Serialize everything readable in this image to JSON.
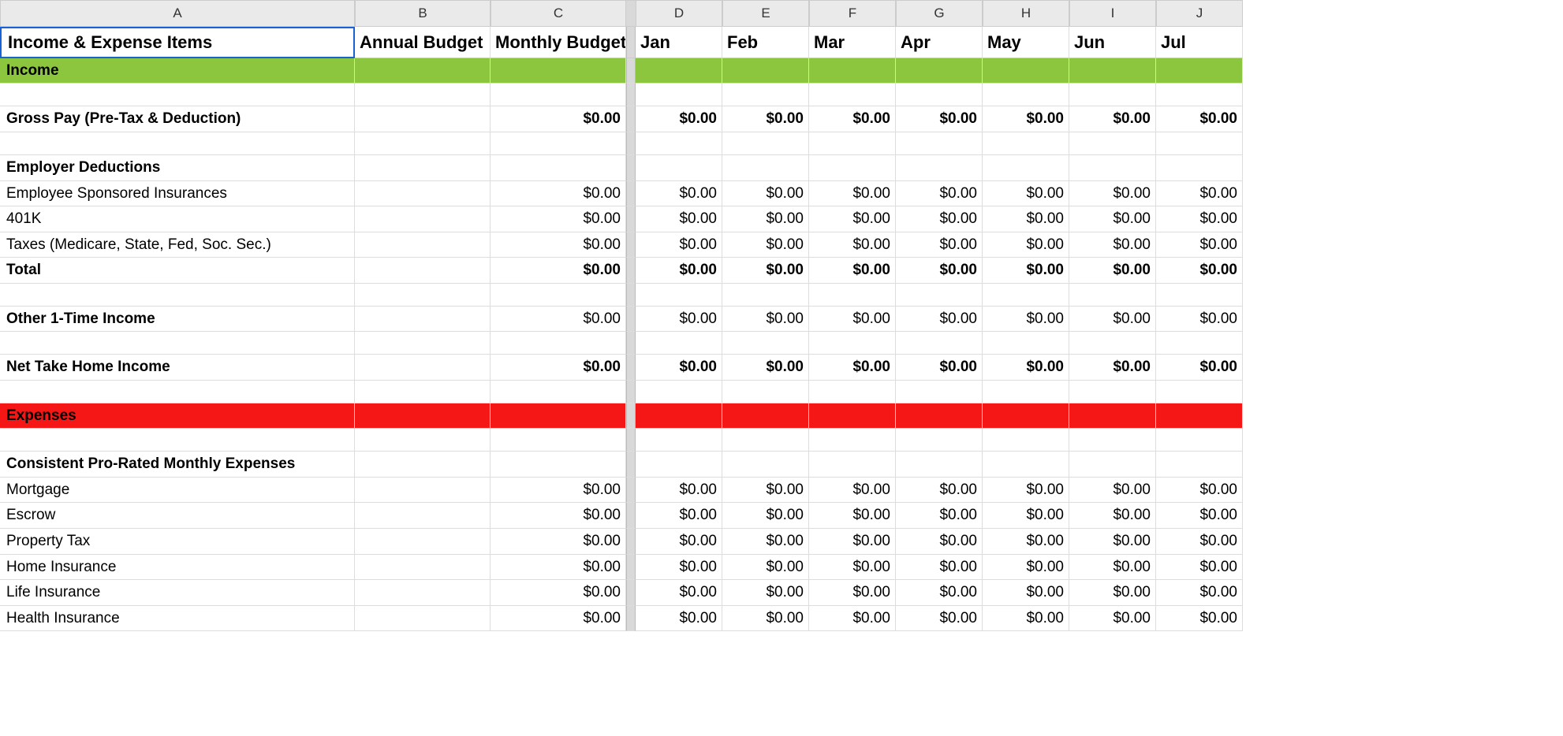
{
  "columnHeaders": [
    "A",
    "B",
    "C",
    "",
    "D",
    "E",
    "F",
    "G",
    "H",
    "I",
    "J"
  ],
  "headerRow": [
    "Income & Expense Items",
    "Annual Budget",
    "Monthly Budget",
    "",
    "Jan",
    "Feb",
    "Mar",
    "Apr",
    "May",
    "Jun",
    "Jul"
  ],
  "zero": "$0.00",
  "rows": [
    {
      "type": "income-band",
      "cells": [
        "Income",
        "",
        "",
        "",
        "",
        "",
        "",
        "",
        "",
        "",
        ""
      ]
    },
    {
      "type": "blank"
    },
    {
      "type": "bold",
      "cells": [
        "Gross Pay (Pre-Tax & Deduction)",
        "",
        "$0.00",
        "",
        "$0.00",
        "$0.00",
        "$0.00",
        "$0.00",
        "$0.00",
        "$0.00",
        "$0.00"
      ]
    },
    {
      "type": "blank"
    },
    {
      "type": "bold",
      "cells": [
        "Employer Deductions",
        "",
        "",
        "",
        "",
        "",
        "",
        "",
        "",
        "",
        ""
      ]
    },
    {
      "type": "normal",
      "cells": [
        "Employee Sponsored Insurances",
        "",
        "$0.00",
        "",
        "$0.00",
        "$0.00",
        "$0.00",
        "$0.00",
        "$0.00",
        "$0.00",
        "$0.00"
      ]
    },
    {
      "type": "normal",
      "cells": [
        "401K",
        "",
        "$0.00",
        "",
        "$0.00",
        "$0.00",
        "$0.00",
        "$0.00",
        "$0.00",
        "$0.00",
        "$0.00"
      ]
    },
    {
      "type": "normal",
      "cells": [
        "Taxes (Medicare, State, Fed, Soc. Sec.)",
        "",
        "$0.00",
        "",
        "$0.00",
        "$0.00",
        "$0.00",
        "$0.00",
        "$0.00",
        "$0.00",
        "$0.00"
      ]
    },
    {
      "type": "bold",
      "cells": [
        "Total",
        "",
        "$0.00",
        "",
        "$0.00",
        "$0.00",
        "$0.00",
        "$0.00",
        "$0.00",
        "$0.00",
        "$0.00"
      ]
    },
    {
      "type": "blank"
    },
    {
      "type": "bold",
      "cells": [
        "Other 1-Time Income",
        "",
        "$0.00",
        "",
        "$0.00",
        "$0.00",
        "$0.00",
        "$0.00",
        "$0.00",
        "$0.00",
        "$0.00"
      ],
      "boldOnlyFirst": true
    },
    {
      "type": "blank"
    },
    {
      "type": "bold",
      "cells": [
        "Net Take Home Income",
        "",
        "$0.00",
        "",
        "$0.00",
        "$0.00",
        "$0.00",
        "$0.00",
        "$0.00",
        "$0.00",
        "$0.00"
      ]
    },
    {
      "type": "blank"
    },
    {
      "type": "expense-band",
      "cells": [
        "Expenses",
        "",
        "",
        "",
        "",
        "",
        "",
        "",
        "",
        "",
        ""
      ]
    },
    {
      "type": "blank"
    },
    {
      "type": "bold",
      "cells": [
        "Consistent Pro-Rated Monthly Expenses",
        "",
        "",
        "",
        "",
        "",
        "",
        "",
        "",
        "",
        ""
      ]
    },
    {
      "type": "normal",
      "cells": [
        "Mortgage",
        "",
        "$0.00",
        "",
        "$0.00",
        "$0.00",
        "$0.00",
        "$0.00",
        "$0.00",
        "$0.00",
        "$0.00"
      ]
    },
    {
      "type": "normal",
      "cells": [
        "Escrow",
        "",
        "$0.00",
        "",
        "$0.00",
        "$0.00",
        "$0.00",
        "$0.00",
        "$0.00",
        "$0.00",
        "$0.00"
      ]
    },
    {
      "type": "normal",
      "cells": [
        "Property Tax",
        "",
        "$0.00",
        "",
        "$0.00",
        "$0.00",
        "$0.00",
        "$0.00",
        "$0.00",
        "$0.00",
        "$0.00"
      ]
    },
    {
      "type": "normal",
      "cells": [
        "Home Insurance",
        "",
        "$0.00",
        "",
        "$0.00",
        "$0.00",
        "$0.00",
        "$0.00",
        "$0.00",
        "$0.00",
        "$0.00"
      ]
    },
    {
      "type": "normal",
      "cells": [
        "Life Insurance",
        "",
        "$0.00",
        "",
        "$0.00",
        "$0.00",
        "$0.00",
        "$0.00",
        "$0.00",
        "$0.00",
        "$0.00"
      ]
    },
    {
      "type": "normal",
      "cells": [
        "Health Insurance",
        "",
        "$0.00",
        "",
        "$0.00",
        "$0.00",
        "$0.00",
        "$0.00",
        "$0.00",
        "$0.00",
        "$0.00"
      ]
    }
  ]
}
